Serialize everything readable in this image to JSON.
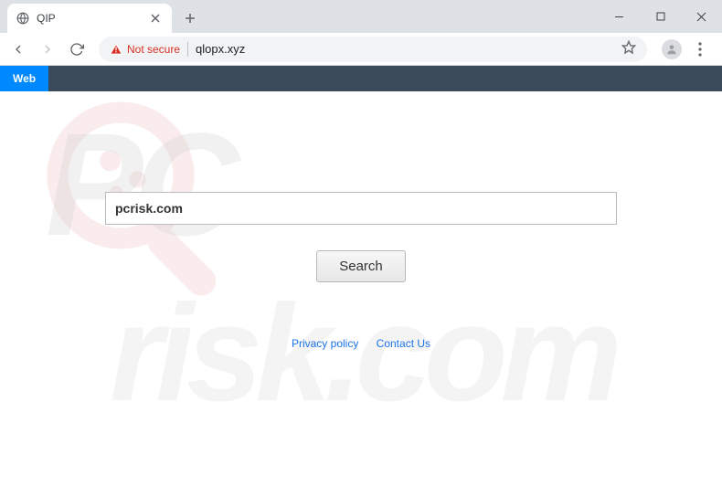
{
  "window": {
    "tab_title": "QIP"
  },
  "toolbar": {
    "not_secure_label": "Not secure",
    "url": "qlopx.xyz"
  },
  "page": {
    "nav_web_label": "Web",
    "search_value": "pcrisk.com",
    "search_button_label": "Search",
    "footer": {
      "privacy": "Privacy policy",
      "contact": "Contact Us"
    }
  },
  "watermark": {
    "line1": "PC",
    "line2": "risk.com"
  }
}
